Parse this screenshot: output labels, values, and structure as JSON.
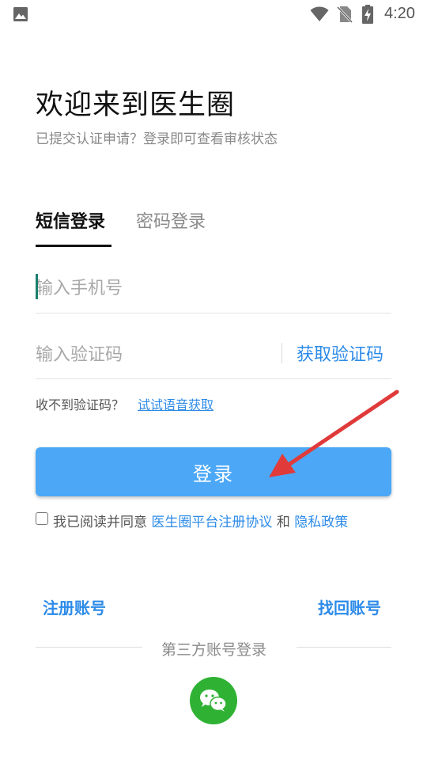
{
  "status_bar": {
    "time": "4:20",
    "icons": [
      "image-icon",
      "wifi-icon",
      "no-sim-icon",
      "battery-charging-icon"
    ]
  },
  "header": {
    "title": "欢迎来到医生圈",
    "subtitle": "已提交认证申请？登录即可查看审核状态"
  },
  "tabs": [
    {
      "label": "短信登录",
      "active": true
    },
    {
      "label": "密码登录",
      "active": false
    }
  ],
  "form": {
    "phone_placeholder": "输入手机号",
    "code_placeholder": "输入验证码",
    "get_code_label": "获取验证码",
    "no_code_text": "收不到验证码？",
    "voice_link": "试试语音获取",
    "login_label": "登录"
  },
  "agreement": {
    "prefix": "我已阅读并同意",
    "terms": "医生圈平台注册协议",
    "and": "和",
    "privacy": "隐私政策",
    "checked": false
  },
  "links": {
    "register": "注册账号",
    "recover": "找回账号"
  },
  "third_party": {
    "label": "第三方账号登录",
    "icon": "wechat-icon"
  },
  "colors": {
    "accent": "#2d8be8",
    "button": "#4ca8f7",
    "wechat": "#2fb233",
    "annotation_arrow": "#e03a3a"
  }
}
